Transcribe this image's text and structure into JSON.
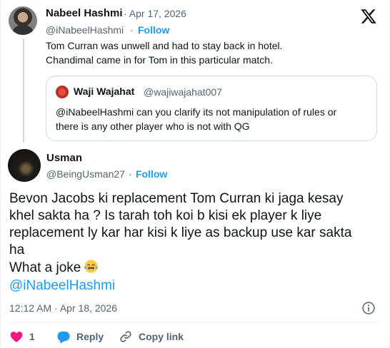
{
  "parent_tweet": {
    "author_name": "Nabeel Hashmi",
    "date": "· Apr 17, 2026",
    "handle": "@iNabeelHashmi",
    "separator": "·",
    "follow_label": "Follow",
    "text": "Tom Curran was unwell and had to stay back in hotel.\nChandimal came in for Tom in this particular match."
  },
  "quoted_tweet": {
    "author_name": "Waji Wajahat",
    "handle": "@wajiwajahat007",
    "text": "@iNabeelHashmi can you clarify its not manipulation of rules or\nthere is any other player who is not with QG"
  },
  "main_tweet": {
    "author_name": "Usman",
    "handle": "@BeingUsman27",
    "separator": "·",
    "follow_label": "Follow",
    "text": "Bevon Jacobs ki replacement Tom Curran ki jaga kesay\nkhel sakta ha ? Is tarah toh koi b kisi ek player k liye\nreplacement ly kar har kisi k liye as backup use kar sakta\nha\nWhat a joke",
    "emoji": "face-with-tears-of-joy",
    "mention": "@iNabeelHashmi",
    "timestamp": "12:12 AM · Apr 18, 2026"
  },
  "actions": {
    "like_count": "1",
    "reply_label": "Reply",
    "copy_link_label": "Copy link"
  },
  "colors": {
    "accent": "#1d9bf0",
    "like": "#f91880",
    "text_secondary": "#536471"
  },
  "icons": {
    "brand": "x-logo-icon",
    "info": "info-icon",
    "like": "heart-icon",
    "reply": "reply-bubble-icon",
    "copy": "link-icon"
  }
}
